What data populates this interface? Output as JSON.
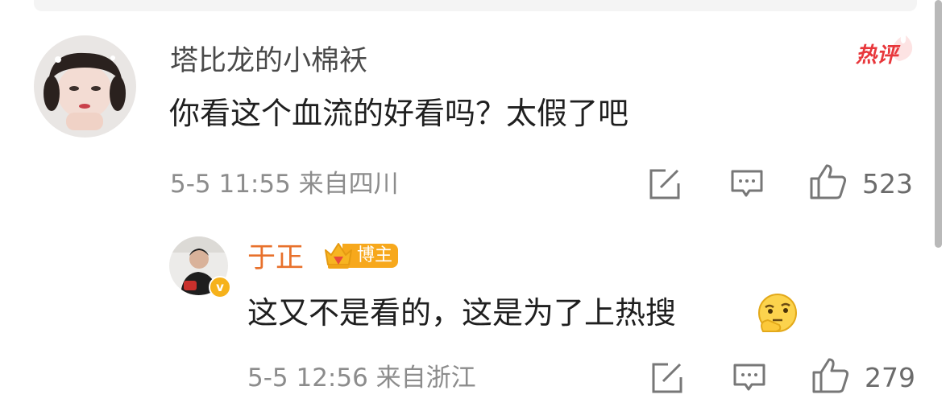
{
  "comments": [
    {
      "username": "塔比龙的小棉袄",
      "text": "你看这个血流的好看吗？太假了吧",
      "meta": "5-5 11:55 来自四川",
      "likes": "523",
      "hot_badge": "热评"
    },
    {
      "username": "于正",
      "badge": "博主",
      "text": "这又不是看的，这是为了上热搜",
      "emoji": "thinking-face-icon",
      "meta": "5-5 12:56 来自浙江",
      "likes": "279"
    }
  ],
  "colors": {
    "author_name": "#e8712c",
    "hot_badge": "#e8373b",
    "blogger_badge": "#f7a81c",
    "meta": "#8c8c8c"
  }
}
